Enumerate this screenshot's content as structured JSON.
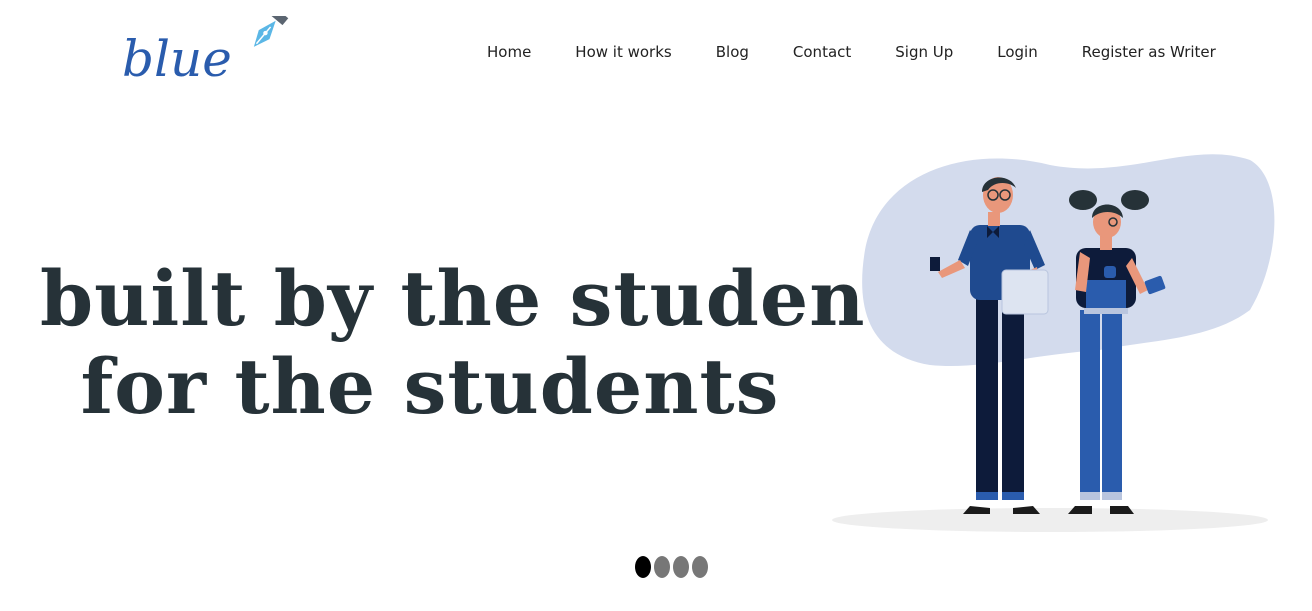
{
  "brand": {
    "logo_text": "blue",
    "logo_icon": "fountain-pen-nib-icon",
    "color": "#2a5cad"
  },
  "nav": {
    "items": [
      {
        "label": "Home"
      },
      {
        "label": "How it works"
      },
      {
        "label": "Blog"
      },
      {
        "label": "Contact"
      },
      {
        "label": "Sign Up"
      },
      {
        "label": "Login"
      },
      {
        "label": "Register as Writer"
      }
    ]
  },
  "hero": {
    "line1": "built by the students",
    "line2": "for the students",
    "text_color": "#263238"
  },
  "illustration": {
    "blob_color": "#d3dbed",
    "shirt_color": "#1f4a8f",
    "pants_dark": "#0d1b3a",
    "pants_blue": "#2a5cad"
  },
  "carousel": {
    "count": 4,
    "active_index": 0
  }
}
